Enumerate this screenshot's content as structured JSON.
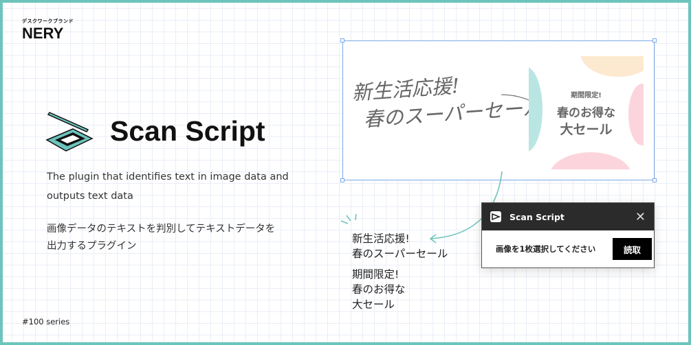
{
  "brand": {
    "tagline": "デスクワークブランド",
    "name": "NERY"
  },
  "product": {
    "title": "Scan Script",
    "description_en": "The plugin that identifies text in image data and outputs text data",
    "description_jp_lines": [
      "画像データのテキストを判別してテキストデータを",
      "出力するプラグイン"
    ]
  },
  "series": "#100 series",
  "sample_image": {
    "handwritten_lines": [
      "新生活応援!",
      "春のスーパーセール"
    ],
    "banner": {
      "small": "期間限定!",
      "line1": "春のお得な",
      "line2": "大セール"
    }
  },
  "output_text": {
    "lines_a": [
      "新生活応援!",
      "春のスーパーセール"
    ],
    "lines_b": [
      "期間限定!",
      "春のお得な",
      "大セール"
    ]
  },
  "dialog": {
    "title": "Scan Script",
    "message": "画像を1枚選択してください",
    "button": "読取"
  },
  "colors": {
    "accent": "#6cc4bc",
    "selection": "#7aa7e8",
    "dialog_header": "#2b2b2b"
  }
}
